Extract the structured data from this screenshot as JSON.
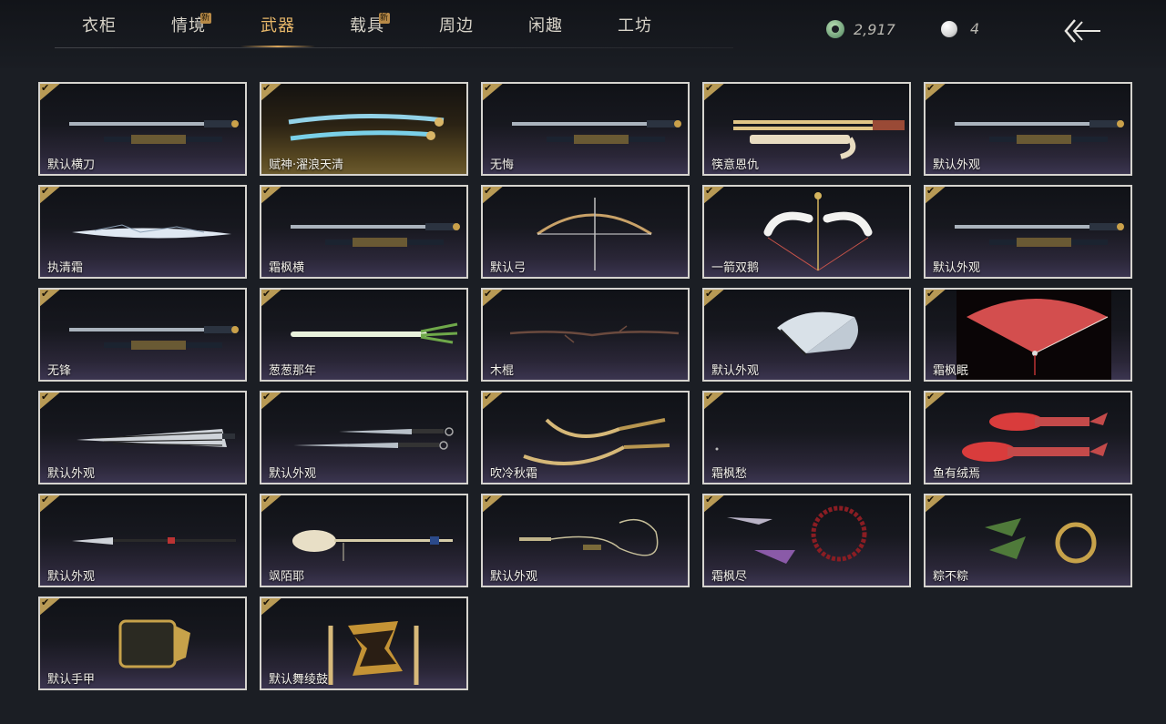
{
  "tabs": [
    {
      "label": "衣柜",
      "badge": ""
    },
    {
      "label": "情境",
      "badge": "新"
    },
    {
      "label": "武器",
      "badge": ""
    },
    {
      "label": "载具",
      "badge": "新"
    },
    {
      "label": "周边",
      "badge": ""
    },
    {
      "label": "闲趣",
      "badge": ""
    },
    {
      "label": "工坊",
      "badge": ""
    }
  ],
  "active_tab": "武器",
  "currency": {
    "jade": "2,917",
    "pearl": "4"
  },
  "items": [
    {
      "name": "默认横刀",
      "art": "sword-icon",
      "owned": true
    },
    {
      "name": "赋神·濯浪天清",
      "art": "glowing-blade-icon",
      "owned": true
    },
    {
      "name": "无悔",
      "art": "sword-icon",
      "owned": true
    },
    {
      "name": "筷意恩仇",
      "art": "chopsticks-icon",
      "owned": true
    },
    {
      "name": "默认外观",
      "art": "sword-icon",
      "owned": true
    },
    {
      "name": "执清霜",
      "art": "frost-blade-icon",
      "owned": true
    },
    {
      "name": "霜枫横",
      "art": "sword-icon",
      "owned": true
    },
    {
      "name": "默认弓",
      "art": "bow-icon",
      "owned": true
    },
    {
      "name": "一箭双鹅",
      "art": "swan-bow-icon",
      "owned": true
    },
    {
      "name": "默认外观",
      "art": "sword-icon",
      "owned": true
    },
    {
      "name": "无锋",
      "art": "sword-icon",
      "owned": true
    },
    {
      "name": "葱葱那年",
      "art": "scallion-icon",
      "owned": true
    },
    {
      "name": "木棍",
      "art": "stick-icon",
      "owned": true
    },
    {
      "name": "默认外观",
      "art": "fan-icon",
      "owned": true
    },
    {
      "name": "霜枫眠",
      "art": "red-fan-icon",
      "owned": true
    },
    {
      "name": "默认外观",
      "art": "umbrella-blade-icon",
      "owned": true
    },
    {
      "name": "默认外观",
      "art": "twin-blades-icon",
      "owned": true
    },
    {
      "name": "吹冷秋霜",
      "art": "curved-blades-icon",
      "owned": true
    },
    {
      "name": "霜枫愁",
      "art": "empty-icon",
      "owned": true
    },
    {
      "name": "鱼有绒焉",
      "art": "fish-blades-icon",
      "owned": true
    },
    {
      "name": "默认外观",
      "art": "spear-icon",
      "owned": true
    },
    {
      "name": "飒陌耶",
      "art": "spoon-staff-icon",
      "owned": true
    },
    {
      "name": "默认外观",
      "art": "rope-dart-icon",
      "owned": true
    },
    {
      "name": "霜枫尽",
      "art": "prayer-beads-icon",
      "owned": true
    },
    {
      "name": "粽不粽",
      "art": "zongzi-dart-icon",
      "owned": true
    },
    {
      "name": "默认手甲",
      "art": "gauntlet-icon",
      "owned": true
    },
    {
      "name": "默认舞绫鼓",
      "art": "drum-icon",
      "owned": true
    }
  ],
  "check_glyph": "✔"
}
